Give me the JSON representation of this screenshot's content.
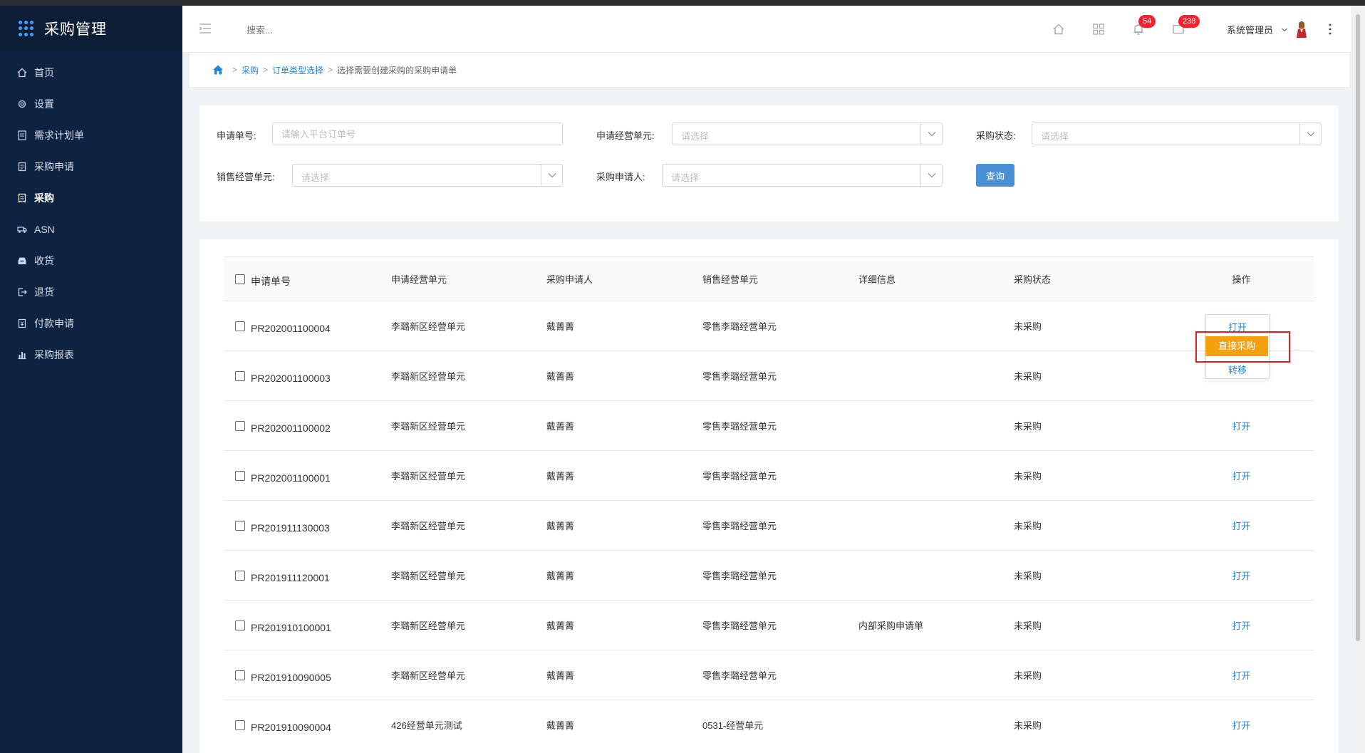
{
  "app": {
    "title": "采购管理"
  },
  "sidebar": {
    "items": [
      {
        "label": "首页",
        "icon": "home-icon"
      },
      {
        "label": "设置",
        "icon": "gear-icon"
      },
      {
        "label": "需求计划单",
        "icon": "document-icon"
      },
      {
        "label": "采购申请",
        "icon": "clipboard-icon"
      },
      {
        "label": "采购",
        "icon": "receipt-icon",
        "active": true
      },
      {
        "label": "ASN",
        "icon": "truck-icon"
      },
      {
        "label": "收货",
        "icon": "inbox-icon"
      },
      {
        "label": "退货",
        "icon": "exit-icon"
      },
      {
        "label": "付款申请",
        "icon": "payment-icon"
      },
      {
        "label": "采购报表",
        "icon": "bar-chart-icon"
      }
    ]
  },
  "header": {
    "search_placeholder": "搜索...",
    "notifications_count": "54",
    "messages_count": "238",
    "user_name": "系统管理员"
  },
  "breadcrumb": {
    "level1": "采购",
    "level2": "订单类型选择",
    "current": "选择需要创建采购的采购申请单"
  },
  "filters": {
    "req_no_label": "申请单号:",
    "req_no_placeholder": "请输入平台订单号",
    "req_unit_label": "申请经营单元:",
    "req_unit_placeholder": "请选择",
    "status_label": "采购状态:",
    "status_placeholder": "请选择",
    "sale_unit_label": "销售经营单元:",
    "sale_unit_placeholder": "请选择",
    "requester_label": "采购申请人:",
    "requester_placeholder": "请选择",
    "query_button": "查询"
  },
  "table": {
    "headers": {
      "id": "申请单号",
      "req_unit": "申请经营单元",
      "requester": "采购申请人",
      "sale_unit": "销售经营单元",
      "detail": "详细信息",
      "status": "采购状态",
      "op": "操作"
    },
    "rows": [
      {
        "id": "PR202001100004",
        "req_unit": "李璐新区经营单元",
        "requester": "戴菁菁",
        "sale_unit": "零售李璐经营单元",
        "detail": "",
        "status": "未采购",
        "op": "打开"
      },
      {
        "id": "PR202001100003",
        "req_unit": "李璐新区经营单元",
        "requester": "戴菁菁",
        "sale_unit": "零售李璐经营单元",
        "detail": "",
        "status": "未采购",
        "op": "打开"
      },
      {
        "id": "PR202001100002",
        "req_unit": "李璐新区经营单元",
        "requester": "戴菁菁",
        "sale_unit": "零售李璐经营单元",
        "detail": "",
        "status": "未采购",
        "op": "打开"
      },
      {
        "id": "PR202001100001",
        "req_unit": "李璐新区经营单元",
        "requester": "戴菁菁",
        "sale_unit": "零售李璐经营单元",
        "detail": "",
        "status": "未采购",
        "op": "打开"
      },
      {
        "id": "PR201911130003",
        "req_unit": "李璐新区经营单元",
        "requester": "戴菁菁",
        "sale_unit": "零售李璐经营单元",
        "detail": "",
        "status": "未采购",
        "op": "打开"
      },
      {
        "id": "PR201911120001",
        "req_unit": "李璐新区经营单元",
        "requester": "戴菁菁",
        "sale_unit": "零售李璐经营单元",
        "detail": "",
        "status": "未采购",
        "op": "打开"
      },
      {
        "id": "PR201910100001",
        "req_unit": "李璐新区经营单元",
        "requester": "戴菁菁",
        "sale_unit": "零售李璐经营单元",
        "detail": "内部采购申请单",
        "status": "未采购",
        "op": "打开"
      },
      {
        "id": "PR201910090005",
        "req_unit": "李璐新区经营单元",
        "requester": "戴菁菁",
        "sale_unit": "零售李璐经营单元",
        "detail": "",
        "status": "未采购",
        "op": "打开"
      },
      {
        "id": "PR201910090004",
        "req_unit": "426经营单元测试",
        "requester": "戴菁菁",
        "sale_unit": "0531-经营单元",
        "detail": "",
        "status": "未采购",
        "op": "打开"
      }
    ]
  },
  "op_dropdown": {
    "open": "打开",
    "direct_purchase": "直接采购",
    "transfer": "转移"
  }
}
